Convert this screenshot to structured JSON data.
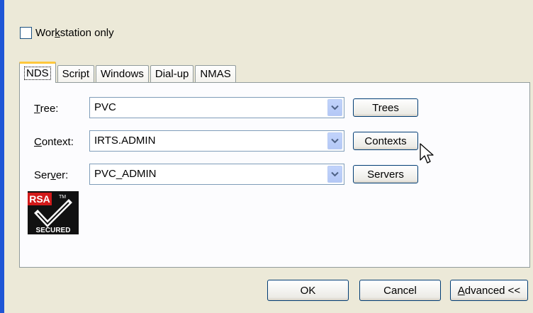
{
  "workstation_only": {
    "label_pre": "Wor",
    "label_key": "k",
    "label_post": "station only",
    "checked": false
  },
  "tabs": [
    {
      "label": "NDS",
      "active": true
    },
    {
      "label": "Script",
      "active": false
    },
    {
      "label": "Windows",
      "active": false
    },
    {
      "label": "Dial-up",
      "active": false
    },
    {
      "label": "NMAS",
      "active": false
    }
  ],
  "fields": {
    "tree": {
      "key": "T",
      "rest": "ree:",
      "value": "PVC",
      "button": "Trees"
    },
    "context": {
      "key": "C",
      "rest": "ontext:",
      "value": "IRTS.ADMIN",
      "button": "Contexts"
    },
    "server": {
      "pre": "Ser",
      "key": "v",
      "rest": "er:",
      "value": "PVC_ADMIN",
      "button": "Servers"
    }
  },
  "logo": {
    "line1": "RSA",
    "tm": "TM",
    "line2": "SECURED"
  },
  "footer": {
    "ok": "OK",
    "cancel": "Cancel",
    "advanced_key": "A",
    "advanced_rest": "dvanced <<"
  },
  "icons": {
    "dropdown": "chevron-down-icon",
    "checkmark": "check-icon",
    "cursor": "arrow-cursor-icon"
  },
  "colors": {
    "window_bg": "#ece9d8",
    "panel_bg": "#fcfcfe",
    "active_tab_accent": "#ffc83c",
    "button_border": "#003c74",
    "left_border": "#1f56d6"
  }
}
